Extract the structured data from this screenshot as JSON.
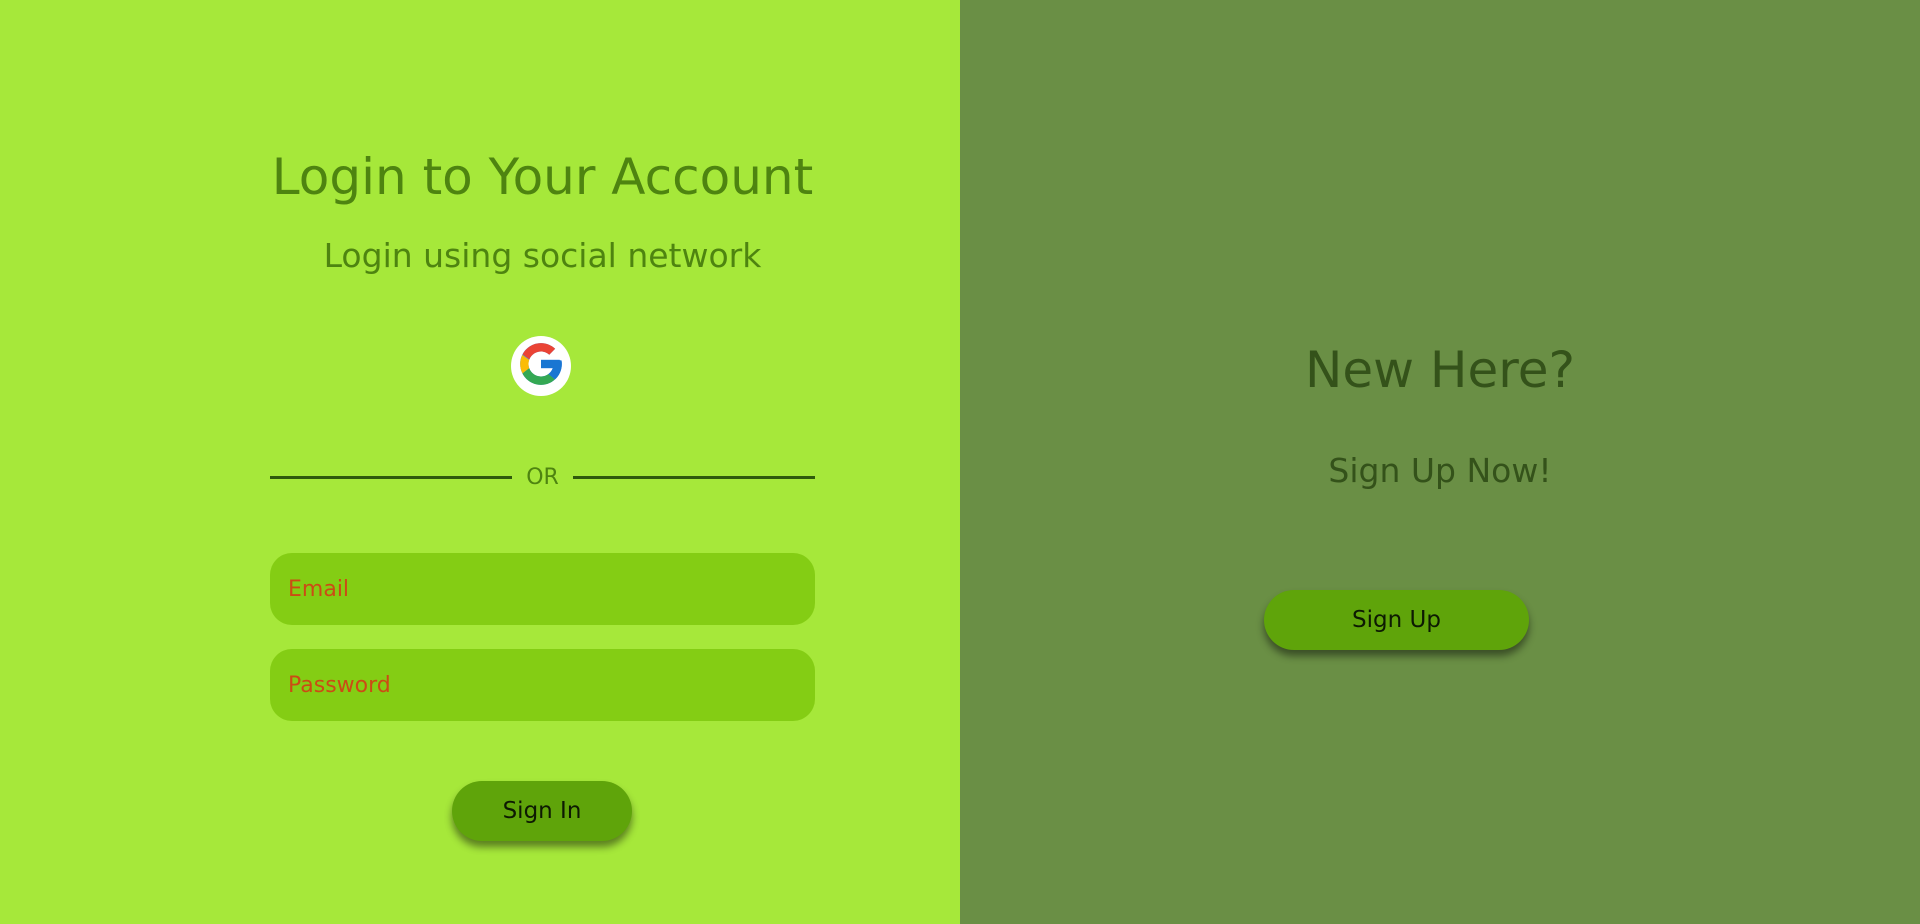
{
  "login": {
    "title": "Login to Your Account",
    "subtitle": "Login using social network",
    "social": [
      {
        "name": "Google",
        "icon": "google-icon"
      }
    ],
    "divider_text": "OR",
    "email_placeholder": "Email",
    "password_placeholder": "Password",
    "signin_label": "Sign In"
  },
  "signup": {
    "title": "New Here?",
    "subtitle": "Sign Up Now!",
    "signup_label": "Sign Up"
  },
  "colors": {
    "left_bg": "#a6e83a",
    "right_bg": "#6a8f45",
    "heading_green": "#4e8410",
    "field_bg": "#84cd14",
    "placeholder": "#cc4b15",
    "button_bg": "#5fa40a"
  }
}
